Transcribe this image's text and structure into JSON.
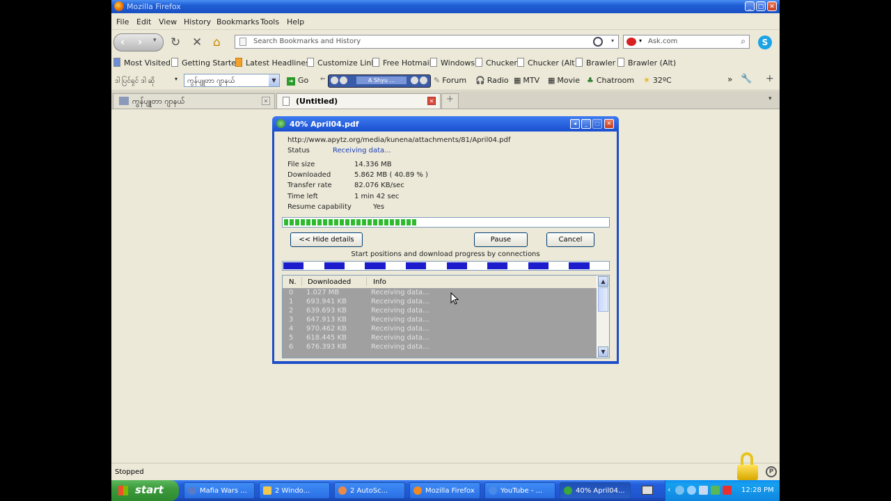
{
  "window": {
    "title": "Mozilla Firefox"
  },
  "menu": [
    "File",
    "Edit",
    "View",
    "History",
    "Bookmarks",
    "Tools",
    "Help"
  ],
  "nav": {
    "url_placeholder": "Search Bookmarks and History",
    "search_text": "Ask.com"
  },
  "bookmarks": [
    "Most Visited",
    "Getting Started",
    "Latest Headlines",
    "Customize Links",
    "Free Hotmail",
    "Windows",
    "Chucker",
    "Chucker (Alt)",
    "Brawler",
    "Brawler (Alt)"
  ],
  "custom_toolbar": {
    "logo_text": "ဒါ ပြင်ရှင် ဒါ ဆို",
    "combo_value": "ကွန်ပျူတာ ဂျာနယ်",
    "go": "Go",
    "player_label": "A Shyu ...",
    "forum": "Forum",
    "radio": "Radio",
    "mtv": "MTV",
    "movie": "Movie",
    "chatroom": "Chatroom",
    "weather": "32ºC",
    "overflow": "»"
  },
  "tabs": [
    {
      "label": "ကွန်ပျူတာ ဂျာနယ်"
    },
    {
      "label": "(Untitled)"
    }
  ],
  "status": "Stopped",
  "dialog": {
    "title": "40% April04.pdf",
    "url": "http://www.apytz.org/media/kunena/attachments/81/April04.pdf",
    "status_label": "Status",
    "status_value": "Receiving data...",
    "fields": [
      {
        "label": "File size",
        "value": "14.336  MB"
      },
      {
        "label": "Downloaded",
        "value": "5.862  MB  ( 40.89 % )"
      },
      {
        "label": "Transfer rate",
        "value": "82.076  KB/sec"
      },
      {
        "label": "Time left",
        "value": "1 min 42 sec"
      },
      {
        "label": "Resume capability",
        "value": "Yes"
      }
    ],
    "progress": 0.4089,
    "buttons": {
      "hide_details": "<< Hide details",
      "pause": "Pause",
      "cancel": "Cancel"
    },
    "connections_caption": "Start positions and download progress by connections",
    "connection_count": 8,
    "table": {
      "headers": [
        "N.",
        "Downloaded",
        "Info"
      ],
      "rows": [
        [
          "0",
          "1.027  MB",
          "Receiving data..."
        ],
        [
          "1",
          "693.941  KB",
          "Receiving data..."
        ],
        [
          "2",
          "639.693  KB",
          "Receiving data..."
        ],
        [
          "3",
          "647.913  KB",
          "Receiving data..."
        ],
        [
          "4",
          "970.462  KB",
          "Receiving data..."
        ],
        [
          "5",
          "618.445  KB",
          "Receiving data..."
        ],
        [
          "6",
          "676.393  KB",
          "Receiving data..."
        ]
      ]
    }
  },
  "taskbar": {
    "start": "start",
    "items": [
      {
        "label": "Mafia Wars ..."
      },
      {
        "label": "2 Windo..."
      },
      {
        "label": "2 AutoSc..."
      },
      {
        "label": "Mozilla Firefox"
      },
      {
        "label": "YouTube - ..."
      },
      {
        "label": "40% April04..."
      }
    ],
    "clock": "12:28 PM"
  },
  "colors": {
    "title_blue": "#1f5fd6",
    "progress_green": "#2dbb2d",
    "conn_blue": "#1c1ccc",
    "start_green": "#3c9a3c"
  }
}
